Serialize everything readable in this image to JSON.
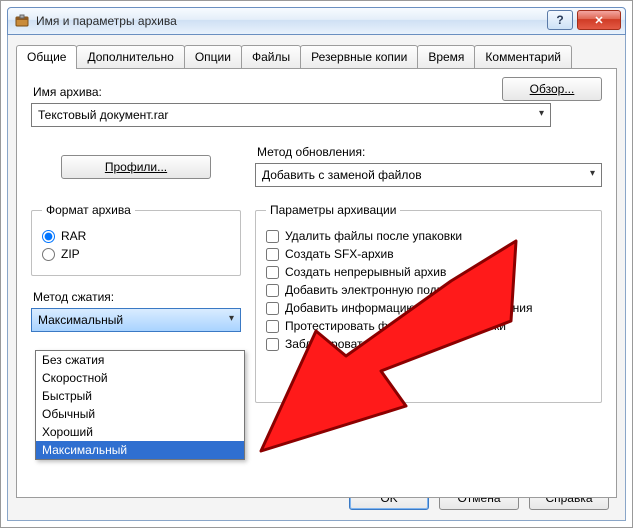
{
  "window": {
    "title": "Имя и параметры архива",
    "help_symbol": "?",
    "close_symbol": "✕"
  },
  "tabs": {
    "general": "Общие",
    "advanced": "Дополнительно",
    "options": "Опции",
    "files": "Файлы",
    "backup": "Резервные копии",
    "time": "Время",
    "comment": "Комментарий"
  },
  "archive_name": {
    "label": "Имя архива:",
    "value": "Текстовый документ.rar",
    "browse": "Обзор..."
  },
  "profiles_btn": "Профили...",
  "update_method": {
    "label": "Метод обновления:",
    "value": "Добавить с заменой файлов"
  },
  "format": {
    "legend": "Формат архива",
    "rar": "RAR",
    "zip": "ZIP"
  },
  "compression": {
    "label": "Метод сжатия:",
    "value": "Максимальный",
    "options": [
      "Без сжатия",
      "Скоростной",
      "Быстрый",
      "Обычный",
      "Хороший",
      "Максимальный"
    ]
  },
  "params": {
    "legend": "Параметры архивации",
    "delete_after": "Удалить файлы после упаковки",
    "sfx": "Создать SFX-архив",
    "solid": "Создать непрерывный архив",
    "sign": "Добавить электронную подпись",
    "recovery": "Добавить информацию для восстановления",
    "test": "Протестировать файлы после упаковки",
    "lock": "Заблокировать архив"
  },
  "buttons": {
    "ok": "OK",
    "cancel": "Отмена",
    "help": "Справка"
  }
}
